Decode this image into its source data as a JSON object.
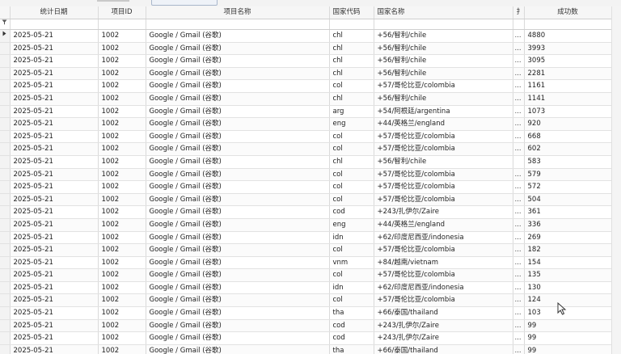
{
  "columns": [
    {
      "key": "date",
      "label": "统计日期"
    },
    {
      "key": "id",
      "label": "项目ID"
    },
    {
      "key": "name",
      "label": "项目名称"
    },
    {
      "key": "code",
      "label": "国家代码"
    },
    {
      "key": "country",
      "label": "国家名称"
    },
    {
      "key": "x",
      "label": "扌…"
    },
    {
      "key": "count",
      "label": "成功数"
    }
  ],
  "filter_icon": "funnel-icon",
  "row_indicator_icon": "triangle-right-icon",
  "rows": [
    {
      "date": "2025-05-21",
      "id": "1002",
      "name": "Google / Gmail (谷歌)",
      "code": "chl",
      "country": "+56/智利/chile",
      "x": "...",
      "count": "4880"
    },
    {
      "date": "2025-05-21",
      "id": "1002",
      "name": "Google / Gmail (谷歌)",
      "code": "chl",
      "country": "+56/智利/chile",
      "x": "...",
      "count": "3993"
    },
    {
      "date": "2025-05-21",
      "id": "1002",
      "name": "Google / Gmail (谷歌)",
      "code": "chl",
      "country": "+56/智利/chile",
      "x": "...",
      "count": "3095"
    },
    {
      "date": "2025-05-21",
      "id": "1002",
      "name": "Google / Gmail (谷歌)",
      "code": "chl",
      "country": "+56/智利/chile",
      "x": "...",
      "count": "2281"
    },
    {
      "date": "2025-05-21",
      "id": "1002",
      "name": "Google / Gmail (谷歌)",
      "code": "col",
      "country": "+57/哥伦比亚/colombia",
      "x": "...",
      "count": "1161"
    },
    {
      "date": "2025-05-21",
      "id": "1002",
      "name": "Google / Gmail (谷歌)",
      "code": "chl",
      "country": "+56/智利/chile",
      "x": "...",
      "count": "1141"
    },
    {
      "date": "2025-05-21",
      "id": "1002",
      "name": "Google / Gmail (谷歌)",
      "code": "arg",
      "country": "+54/阿根廷/argentina",
      "x": "...",
      "count": "1073"
    },
    {
      "date": "2025-05-21",
      "id": "1002",
      "name": "Google / Gmail (谷歌)",
      "code": "eng",
      "country": "+44/英格兰/england",
      "x": "...",
      "count": "920"
    },
    {
      "date": "2025-05-21",
      "id": "1002",
      "name": "Google / Gmail (谷歌)",
      "code": "col",
      "country": "+57/哥伦比亚/colombia",
      "x": "...",
      "count": "668"
    },
    {
      "date": "2025-05-21",
      "id": "1002",
      "name": "Google / Gmail (谷歌)",
      "code": "col",
      "country": "+57/哥伦比亚/colombia",
      "x": "...",
      "count": "602"
    },
    {
      "date": "2025-05-21",
      "id": "1002",
      "name": "Google / Gmail (谷歌)",
      "code": "chl",
      "country": "+56/智利/chile",
      "x": "",
      "count": "583"
    },
    {
      "date": "2025-05-21",
      "id": "1002",
      "name": "Google / Gmail (谷歌)",
      "code": "col",
      "country": "+57/哥伦比亚/colombia",
      "x": "...",
      "count": "579"
    },
    {
      "date": "2025-05-21",
      "id": "1002",
      "name": "Google / Gmail (谷歌)",
      "code": "col",
      "country": "+57/哥伦比亚/colombia",
      "x": "...",
      "count": "572"
    },
    {
      "date": "2025-05-21",
      "id": "1002",
      "name": "Google / Gmail (谷歌)",
      "code": "col",
      "country": "+57/哥伦比亚/colombia",
      "x": "...",
      "count": "504"
    },
    {
      "date": "2025-05-21",
      "id": "1002",
      "name": "Google / Gmail (谷歌)",
      "code": "cod",
      "country": "+243/扎伊尔/Zaire",
      "x": "...",
      "count": "361"
    },
    {
      "date": "2025-05-21",
      "id": "1002",
      "name": "Google / Gmail (谷歌)",
      "code": "eng",
      "country": "+44/英格兰/england",
      "x": "...",
      "count": "336"
    },
    {
      "date": "2025-05-21",
      "id": "1002",
      "name": "Google / Gmail (谷歌)",
      "code": "idn",
      "country": "+62/印度尼西亚/indonesia",
      "x": "...",
      "count": "269"
    },
    {
      "date": "2025-05-21",
      "id": "1002",
      "name": "Google / Gmail (谷歌)",
      "code": "col",
      "country": "+57/哥伦比亚/colombia",
      "x": "...",
      "count": "182"
    },
    {
      "date": "2025-05-21",
      "id": "1002",
      "name": "Google / Gmail (谷歌)",
      "code": "vnm",
      "country": "+84/越南/vietnam",
      "x": "...",
      "count": "154"
    },
    {
      "date": "2025-05-21",
      "id": "1002",
      "name": "Google / Gmail (谷歌)",
      "code": "col",
      "country": "+57/哥伦比亚/colombia",
      "x": "...",
      "count": "135"
    },
    {
      "date": "2025-05-21",
      "id": "1002",
      "name": "Google / Gmail (谷歌)",
      "code": "idn",
      "country": "+62/印度尼西亚/indonesia",
      "x": "...",
      "count": "130"
    },
    {
      "date": "2025-05-21",
      "id": "1002",
      "name": "Google / Gmail (谷歌)",
      "code": "col",
      "country": "+57/哥伦比亚/colombia",
      "x": "...",
      "count": "124"
    },
    {
      "date": "2025-05-21",
      "id": "1002",
      "name": "Google / Gmail (谷歌)",
      "code": "tha",
      "country": "+66/泰国/thailand",
      "x": "...",
      "count": "103"
    },
    {
      "date": "2025-05-21",
      "id": "1002",
      "name": "Google / Gmail (谷歌)",
      "code": "cod",
      "country": "+243/扎伊尔/Zaire",
      "x": "...",
      "count": "99"
    },
    {
      "date": "2025-05-21",
      "id": "1002",
      "name": "Google / Gmail (谷歌)",
      "code": "cod",
      "country": "+243/扎伊尔/Zaire",
      "x": "...",
      "count": "99"
    },
    {
      "date": "2025-05-21",
      "id": "1002",
      "name": "Google / Gmail (谷歌)",
      "code": "tha",
      "country": "+66/泰国/thailand",
      "x": "...",
      "count": "99"
    }
  ]
}
